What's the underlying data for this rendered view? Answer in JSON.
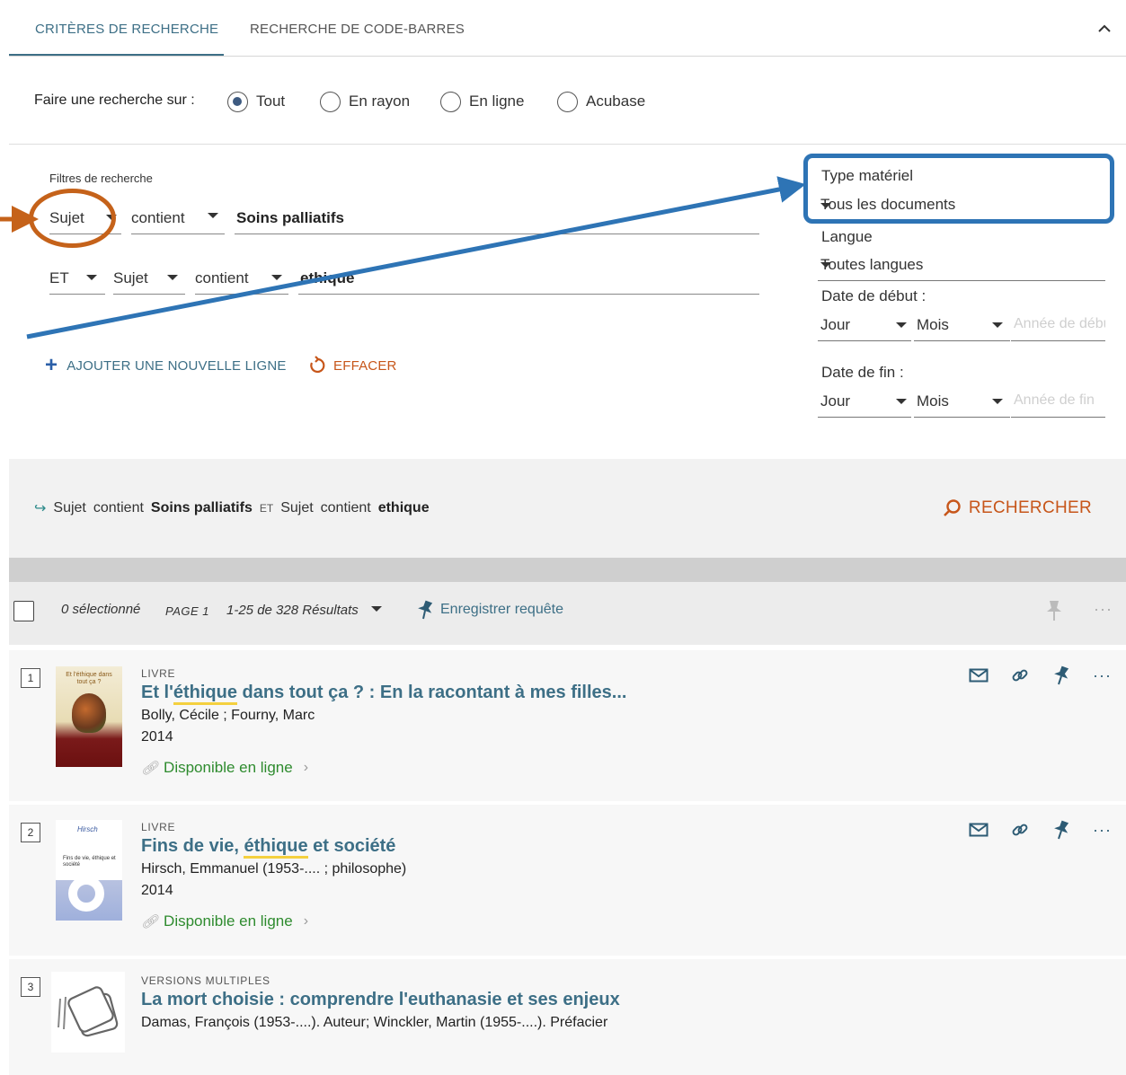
{
  "tabs": {
    "criteria": "CRITÈRES DE RECHERCHE",
    "barcode": "RECHERCHE DE CODE-BARRES"
  },
  "scope": {
    "label": "Faire une recherche sur :",
    "options": [
      "Tout",
      "En rayon",
      "En ligne",
      "Acubase"
    ],
    "selected": "Tout"
  },
  "filters": {
    "title": "Filtres de recherche",
    "row1": {
      "field": "Sujet",
      "operator": "contient",
      "value": "Soins palliatifs"
    },
    "row2": {
      "bool": "ET",
      "field": "Sujet",
      "operator": "contient",
      "value": "ethique"
    },
    "add_line": "AJOUTER UNE NOUVELLE LIGNE",
    "clear": "EFFACER"
  },
  "side_filters": {
    "material_label": "Type matériel",
    "material_value": "Tous les documents",
    "language_label": "Langue",
    "language_value": "Toutes langues",
    "start_label": "Date de début :",
    "end_label": "Date de fin :",
    "day": "Jour",
    "month": "Mois",
    "start_year_placeholder": "Année de début",
    "end_year_placeholder": "Année de fin"
  },
  "query_summary": {
    "field1": "Sujet",
    "op1": "contient",
    "val1": "Soins palliatifs",
    "bool": "ET",
    "field2": "Sujet",
    "op2": "contient",
    "val2": "ethique",
    "search": "RECHERCHER"
  },
  "results_toolbar": {
    "selected": "0 sélectionné",
    "page": "PAGE 1",
    "range": "1-25 de 328 Résultats",
    "save_query": "Enregistrer requête"
  },
  "results": [
    {
      "num": "1",
      "type": "LIVRE",
      "title_pre": "Et l'",
      "title_hl": "éthique",
      "title_post": " dans tout ça ? : En la racontant à mes filles...",
      "author": "Bolly, Cécile ; Fourny, Marc",
      "year": "2014",
      "availability": "Disponible en ligne",
      "cover_text": "Et l'éthique dans tout ça ?"
    },
    {
      "num": "2",
      "type": "LIVRE",
      "title_pre": "Fins de vie, ",
      "title_hl": "éthique",
      "title_post": " et société",
      "author": "Hirsch, Emmanuel (1953-.... ; philosophe)",
      "year": "2014",
      "availability": "Disponible en ligne",
      "cover_text": "Fins de vie, éthique et société"
    },
    {
      "num": "3",
      "type": "VERSIONS MULTIPLES",
      "title_pre": "La mort choisie : comprendre l'euthanasie et ses enjeux",
      "title_hl": "",
      "title_post": "",
      "author": "Damas, François (1953-....). Auteur; Winckler, Martin (1955-....). Préfacier"
    }
  ],
  "colors": {
    "accent": "#3d6f86",
    "orange": "#c7561a",
    "available": "#2e8b2e",
    "annotation_blue": "#2e74b5",
    "annotation_orange": "#c5621a"
  }
}
